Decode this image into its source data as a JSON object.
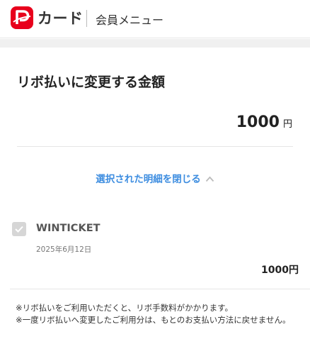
{
  "header": {
    "logo_text": "カード",
    "menu_label": "会員メニュー",
    "brand_color": "#e8001c"
  },
  "revo": {
    "title": "リボ払いに変更する金額",
    "total_value": "1000",
    "total_unit": "円"
  },
  "toggle": {
    "label": "選択された明細を閉じる",
    "icon": "chevron-up-icon",
    "color": "#3d8de0"
  },
  "items": [
    {
      "name": "WINTICKET",
      "date": "2025年6月12日",
      "amount": "1000円",
      "checked": true
    }
  ],
  "notes": [
    "※リボ払いをご利用いただくと、リボ手数料がかかります。",
    "※一度リボ払いへ変更したご利用分は、もとのお支払い方法に戻せません。"
  ]
}
